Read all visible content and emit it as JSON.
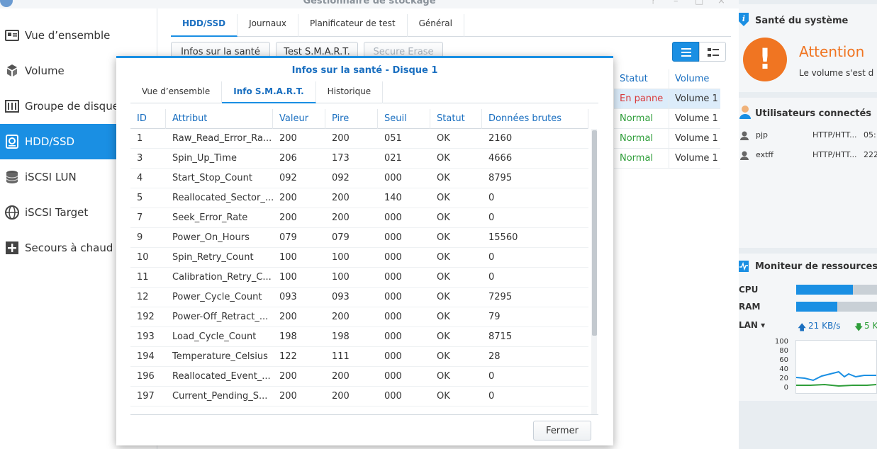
{
  "window": {
    "title": "Gestionnaire de stockage",
    "help_icon": "?",
    "min_icon": "–",
    "max_icon": "□",
    "close_icon": "×"
  },
  "sidebar": {
    "items": [
      {
        "label": "Vue d’ensemble",
        "icon": "overview-icon"
      },
      {
        "label": "Volume",
        "icon": "volume-icon"
      },
      {
        "label": "Groupe de disques",
        "icon": "disk-group-icon"
      },
      {
        "label": "HDD/SSD",
        "icon": "hdd-icon"
      },
      {
        "label": "iSCSI LUN",
        "icon": "iscsi-lun-icon"
      },
      {
        "label": "iSCSI Target",
        "icon": "iscsi-target-icon"
      },
      {
        "label": "Secours à chaud",
        "icon": "hot-spare-icon"
      }
    ],
    "active_index": 3
  },
  "main": {
    "tabs": [
      "HDD/SSD",
      "Journaux",
      "Planificateur de test",
      "Général"
    ],
    "active_tab": 0,
    "buttons": {
      "health": "Infos sur la santé",
      "smart_test": "Test S.M.A.R.T.",
      "secure_erase": "Secure Erase"
    },
    "table": {
      "headers": [
        "Statut",
        "Volume"
      ],
      "rows": [
        {
          "status": "En panne",
          "volume": "Volume 1"
        },
        {
          "status": "Normal",
          "volume": "Volume 1"
        },
        {
          "status": "Normal",
          "volume": "Volume 1"
        },
        {
          "status": "Normal",
          "volume": "Volume 1"
        }
      ]
    }
  },
  "widgets": {
    "health": {
      "title": "Santé du système",
      "status": "Attention",
      "message": "Le volume s'est d",
      "alert_glyph": "!"
    },
    "users": {
      "title": "Utilisateurs connectés",
      "rows": [
        {
          "user": "pjp",
          "protocol": "HTTP/HTT...",
          "time": "05:"
        },
        {
          "user": "extff",
          "protocol": "HTTP/HTT...",
          "time": "222"
        }
      ]
    },
    "resources": {
      "title": "Moniteur de ressources",
      "cpu_label": "CPU",
      "ram_label": "RAM",
      "lan_label": "LAN ▾",
      "cpu_percent": 70,
      "ram_percent": 51,
      "upload": "21 KB/s",
      "download": "5 K",
      "y_ticks": [
        "100",
        "80",
        "60",
        "40",
        "20",
        "0"
      ]
    }
  },
  "dialog": {
    "title": "Infos sur la santé - Disque 1",
    "tabs": [
      "Vue d’ensemble",
      "Info S.M.A.R.T.",
      "Historique"
    ],
    "active_tab": 1,
    "columns": [
      "ID",
      "Attribut",
      "Valeur",
      "Pire",
      "Seuil",
      "Statut",
      "Données brutes"
    ],
    "rows": [
      [
        "1",
        "Raw_Read_Error_Ra...",
        "200",
        "200",
        "051",
        "OK",
        "2160"
      ],
      [
        "3",
        "Spin_Up_Time",
        "206",
        "173",
        "021",
        "OK",
        "4666"
      ],
      [
        "4",
        "Start_Stop_Count",
        "092",
        "092",
        "000",
        "OK",
        "8795"
      ],
      [
        "5",
        "Reallocated_Sector_...",
        "200",
        "200",
        "140",
        "OK",
        "0"
      ],
      [
        "7",
        "Seek_Error_Rate",
        "200",
        "200",
        "000",
        "OK",
        "0"
      ],
      [
        "9",
        "Power_On_Hours",
        "079",
        "079",
        "000",
        "OK",
        "15560"
      ],
      [
        "10",
        "Spin_Retry_Count",
        "100",
        "100",
        "000",
        "OK",
        "0"
      ],
      [
        "11",
        "Calibration_Retry_C...",
        "100",
        "100",
        "000",
        "OK",
        "0"
      ],
      [
        "12",
        "Power_Cycle_Count",
        "093",
        "093",
        "000",
        "OK",
        "7295"
      ],
      [
        "192",
        "Power-Off_Retract_...",
        "200",
        "200",
        "000",
        "OK",
        "79"
      ],
      [
        "193",
        "Load_Cycle_Count",
        "198",
        "198",
        "000",
        "OK",
        "8715"
      ],
      [
        "194",
        "Temperature_Celsius",
        "122",
        "111",
        "000",
        "OK",
        "28"
      ],
      [
        "196",
        "Reallocated_Event_...",
        "200",
        "200",
        "000",
        "OK",
        "0"
      ],
      [
        "197",
        "Current_Pending_S...",
        "200",
        "200",
        "000",
        "OK",
        "0"
      ]
    ],
    "close_label": "Fermer"
  },
  "colors": {
    "accent": "#1a8fe3",
    "warning": "#f07522",
    "fail": "#d9393b",
    "ok": "#2f9e3a"
  }
}
